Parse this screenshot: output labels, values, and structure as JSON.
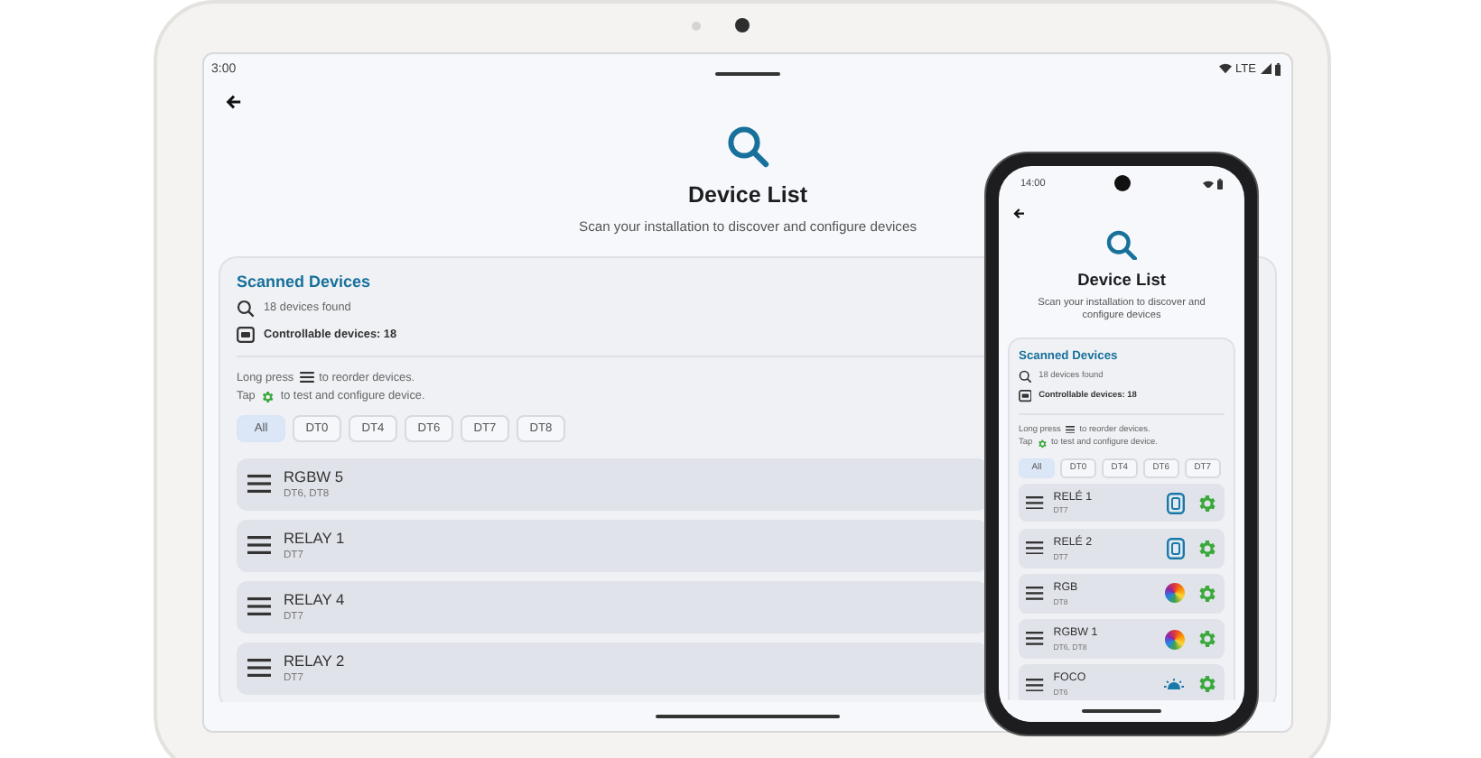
{
  "tablet": {
    "status_bar": {
      "time": "3:00",
      "network": "LTE"
    },
    "screen": {
      "title": "Device List",
      "subtitle": "Scan your installation to discover and configure devices",
      "card": {
        "title": "Scanned Devices",
        "found": "18 devices found",
        "controllable": "Controllable devices: 18",
        "reorder_hint": [
          "Long press",
          "to reorder devices."
        ],
        "tap_hint": [
          "Tap",
          "to test and configure device."
        ]
      },
      "filters": [
        {
          "label": "All",
          "selected": true
        },
        {
          "label": "DT0",
          "selected": false
        },
        {
          "label": "DT4",
          "selected": false
        },
        {
          "label": "DT6",
          "selected": false
        },
        {
          "label": "DT7",
          "selected": false
        },
        {
          "label": "DT8",
          "selected": false
        }
      ],
      "devices": [
        {
          "name": "RGBW 5",
          "types": "DT6, DT8"
        },
        {
          "name": "RELAY 1",
          "types": "DT7"
        },
        {
          "name": "RELAY 4",
          "types": "DT7"
        },
        {
          "name": "RELAY 2",
          "types": "DT7"
        }
      ]
    }
  },
  "phone": {
    "status_bar": {
      "time": "14:00"
    },
    "screen": {
      "title": "Device List",
      "subtitle": "Scan your installation to discover and configure devices",
      "card": {
        "title": "Scanned Devices",
        "found": "18 devices found",
        "controllable": "Controllable devices: 18",
        "reorder_hint": [
          "Long press",
          "to reorder devices."
        ],
        "tap_hint": [
          "Tap",
          "to test and configure device."
        ]
      },
      "filters": [
        {
          "label": "All",
          "selected": true
        },
        {
          "label": "DT0",
          "selected": false
        },
        {
          "label": "DT4",
          "selected": false
        },
        {
          "label": "DT6",
          "selected": false
        },
        {
          "label": "DT7",
          "selected": false
        }
      ],
      "devices": [
        {
          "name": "RELÉ 1",
          "types": "DT7",
          "kind": "relay"
        },
        {
          "name": "RELÉ 2",
          "types": "DT7",
          "kind": "relay"
        },
        {
          "name": "RGB",
          "types": "DT8",
          "kind": "color"
        },
        {
          "name": "RGBW 1",
          "types": "DT6, DT8",
          "kind": "color"
        },
        {
          "name": "FOCO",
          "types": "DT6",
          "kind": "light"
        }
      ]
    }
  }
}
